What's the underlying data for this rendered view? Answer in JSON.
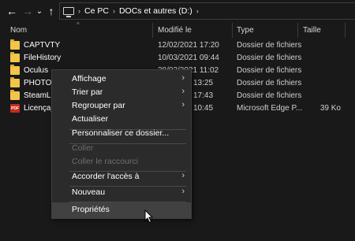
{
  "nav": {
    "back": "←",
    "forward": "→",
    "recent": "⌄",
    "up": "↑",
    "breadcrumb": [
      "Ce PC",
      "DOCs et autres (D:)"
    ],
    "chevron": "›"
  },
  "columns": {
    "name": "Nom",
    "modified": "Modifié le",
    "type": "Type",
    "size": "Taille",
    "sort_arrow": "^"
  },
  "files": [
    {
      "name": "CAPTVTY",
      "modified": "12/02/2021 17:20",
      "type": "Dossier de fichiers",
      "size": "",
      "icon": "folder-icon"
    },
    {
      "name": "FileHistory",
      "modified": "10/03/2021 09:44",
      "type": "Dossier de fichiers",
      "size": "",
      "icon": "folder-icon"
    },
    {
      "name": "Oculus",
      "modified": "28/02/2021 11:02",
      "type": "Dossier de fichiers",
      "size": "",
      "icon": "folder-icon"
    },
    {
      "name": "PHOTOS",
      "modified": "13:25",
      "type": "Dossier de fichiers",
      "size": "",
      "icon": "folder-icon"
    },
    {
      "name": "SteamLibr",
      "modified": "17:43",
      "type": "Dossier de fichiers",
      "size": "",
      "icon": "folder-icon"
    },
    {
      "name": "Licença_p",
      "modified": "10:45",
      "type": "Microsoft Edge P...",
      "size": "39 Ko",
      "icon": "pdf-icon",
      "icon_text": "PDF"
    }
  ],
  "menu": {
    "affichage": "Affichage",
    "trier": "Trier par",
    "regrouper": "Regrouper par",
    "actualiser": "Actualiser",
    "personnaliser": "Personnaliser ce dossier...",
    "coller": "Coller",
    "coller_raccourci": "Coller le raccourci",
    "acces": "Accorder l'accès à",
    "nouveau": "Nouveau",
    "proprietes": "Propriétés",
    "submenu_arrow": "›"
  },
  "colors": {
    "background": "#191919",
    "menu_bg": "#2b2b2b",
    "menu_hover": "#414141",
    "folder": "#f2c649",
    "pdf": "#c42b1c"
  }
}
